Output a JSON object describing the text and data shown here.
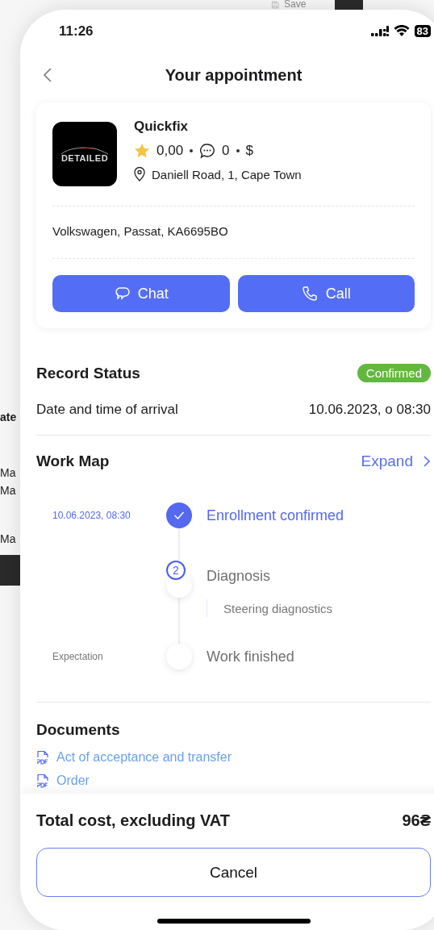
{
  "background_app": {
    "save_button": "Save",
    "column_header": "ate",
    "cells": [
      "Ma",
      "Ma",
      "Ma"
    ]
  },
  "status_bar": {
    "time": "11:26",
    "battery": "83"
  },
  "header": {
    "title": "Your appointment"
  },
  "business": {
    "logo_text": "DETAILED",
    "name": "Quickfix",
    "rating": "0,00",
    "reviews": "0",
    "price": "$",
    "address": "Daniell Road, 1, Cape Town"
  },
  "vehicle": "Volkswagen, Passat, KA6695BO",
  "actions": [
    {
      "label": "Chat",
      "kind": "chat"
    },
    {
      "label": "Call",
      "kind": "call"
    }
  ],
  "record_status": {
    "title": "Record Status",
    "status": "Confirmed",
    "arrival_label": "Date and time of arrival",
    "arrival_value": "10.06.2023, o 08:30"
  },
  "work_map": {
    "title": "Work Map",
    "expand": "Expand",
    "steps": [
      {
        "date": "10.06.2023, 08:30",
        "title": "Enrollment confirmed",
        "kind": "done"
      },
      {
        "number": "2",
        "title": "Diagnosis",
        "kind": "current",
        "subtasks": [
          "Steering diagnostics"
        ]
      },
      {
        "date": "Expectation",
        "title": "Work finished",
        "kind": "pending"
      }
    ]
  },
  "documents": {
    "title": "Documents",
    "items": [
      "Act of acceptance and transfer",
      "Order"
    ]
  },
  "footer": {
    "total_label": "Total cost, excluding VAT",
    "total": "96₴",
    "cancel": "Cancel"
  }
}
